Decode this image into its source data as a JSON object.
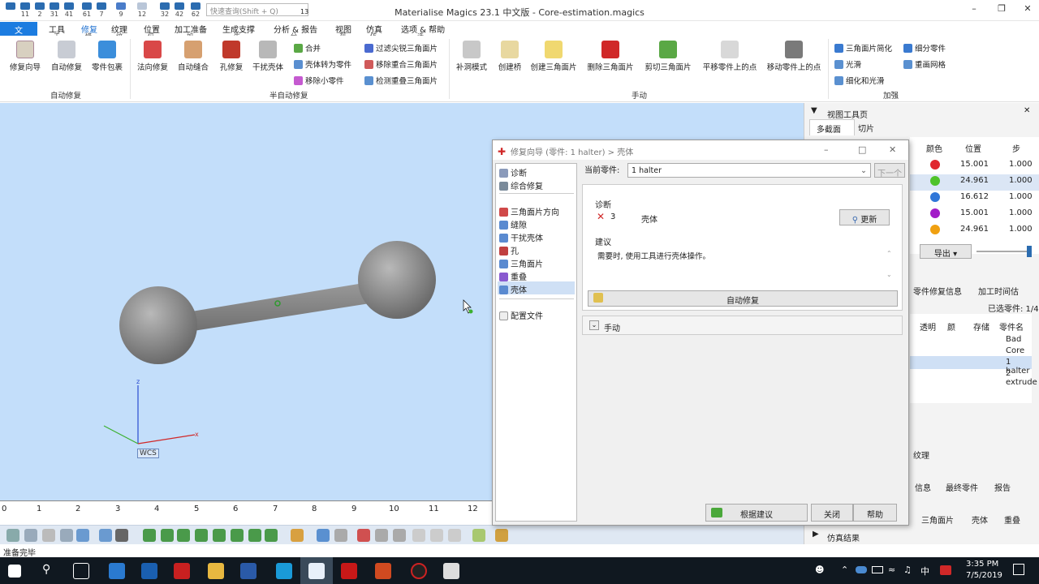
{
  "window": {
    "title": "Materialise Magics 23.1 中文版 - Core-estimation.magics"
  },
  "quick_access": {
    "badges": [
      "11",
      "2",
      "31",
      "41",
      "61",
      "7",
      "9",
      "12",
      "32",
      "42",
      "62",
      "13"
    ],
    "search_placeholder": "快速查询(Shift + Q)"
  },
  "menu": {
    "file": "文",
    "items": [
      "工具",
      "修复",
      "纹理",
      "位置",
      "加工准备",
      "生成支撑",
      "分析 & 报告",
      "视图",
      "仿真",
      "选项 & 帮助"
    ],
    "key_tips": [
      "工",
      "修",
      "纹",
      "位",
      "加",
      "生",
      "分",
      "视",
      "仿",
      "选"
    ]
  },
  "ribbon": {
    "auto_group": {
      "label": "自动修复",
      "buttons": [
        "修复向导",
        "自动修复",
        "零件包裹"
      ]
    },
    "semi_group": {
      "label": "半自动修复",
      "buttons": [
        "法向修复",
        "自动缝合",
        "孔修复",
        "干扰壳体"
      ],
      "small_col1": [
        "合并",
        "壳体转为零件",
        "移除小零件"
      ],
      "small_col2": [
        "过滤尖锐三角面片",
        "移除重合三角面片",
        "检测重叠三角面片"
      ]
    },
    "manual_group": {
      "label": "手动",
      "buttons": [
        "补洞模式",
        "创建桥",
        "创建三角面片",
        "删除三角面片",
        "剪切三角面片",
        "平移零件上的点",
        "移动零件上的点"
      ]
    },
    "enhance_group": {
      "label": "加强",
      "small": [
        "三角面片简化",
        "细分零件",
        "光滑",
        "重画网格",
        "细化和光滑"
      ]
    }
  },
  "viewport": {
    "wcs_label": "WCS",
    "axis_z": "z",
    "axis_x": "x"
  },
  "ruler": {
    "ticks": [
      "0",
      "1",
      "2",
      "3",
      "4",
      "5",
      "6",
      "7",
      "8",
      "9",
      "10",
      "11",
      "12"
    ]
  },
  "status": {
    "text": "准备完毕"
  },
  "right_panel": {
    "view_toolbar_title": "视图工具页",
    "tabs": [
      "多截面",
      "切片"
    ],
    "table_headers": [
      "颜色",
      "位置",
      "步"
    ],
    "rows": [
      {
        "color": "#e0262e",
        "pos": "15.001",
        "step": "1.000"
      },
      {
        "color": "#4fc32a",
        "pos": "24.961",
        "step": "1.000"
      },
      {
        "color": "#2f76d8",
        "pos": "16.612",
        "step": "1.000"
      },
      {
        "color": "#a21cc8",
        "pos": "15.001",
        "step": "1.000"
      },
      {
        "color": "#f0a010",
        "pos": "24.961",
        "step": "1.000"
      }
    ],
    "export_label": "导出",
    "parts_tabs": [
      "零件修复信息",
      "加工时间估"
    ],
    "selected": "已选零件: 1/4",
    "parts_headers": [
      "透明",
      "颜",
      "存储",
      "零件名"
    ],
    "parts": [
      "Bad",
      "Core",
      "1 halter",
      "2 extrude"
    ],
    "texture_label": "纹理",
    "info_tabs": [
      "信息",
      "最终零件",
      "报告"
    ],
    "bottom_tabs": [
      "三角面片",
      "壳体",
      "重叠"
    ],
    "sim_label": "仿真结果"
  },
  "dialog": {
    "title": "修复向导 (零件: 1 halter) > 壳体",
    "tree": [
      "诊断",
      "综合修复",
      "三角面片方向",
      "缝隙",
      "干扰壳体",
      "孔",
      "三角面片",
      "重叠",
      "壳体",
      "配置文件"
    ],
    "current_part_label": "当前零件:",
    "current_part_value": "1 halter",
    "next_label": "下一个",
    "diagnosis_label": "诊断",
    "count": "3",
    "shell_label": "壳体",
    "update_label": "更新",
    "advice_label": "建议",
    "advice_text": "需要时, 使用工具进行壳体操作。",
    "auto_fix": "自动修复",
    "manual": "手动",
    "follow_btn": "根据建议",
    "close_btn": "关闭",
    "help_btn": "帮助"
  },
  "taskbar": {
    "time": "3:35 PM",
    "date": "7/5/2019",
    "ime": "中"
  }
}
